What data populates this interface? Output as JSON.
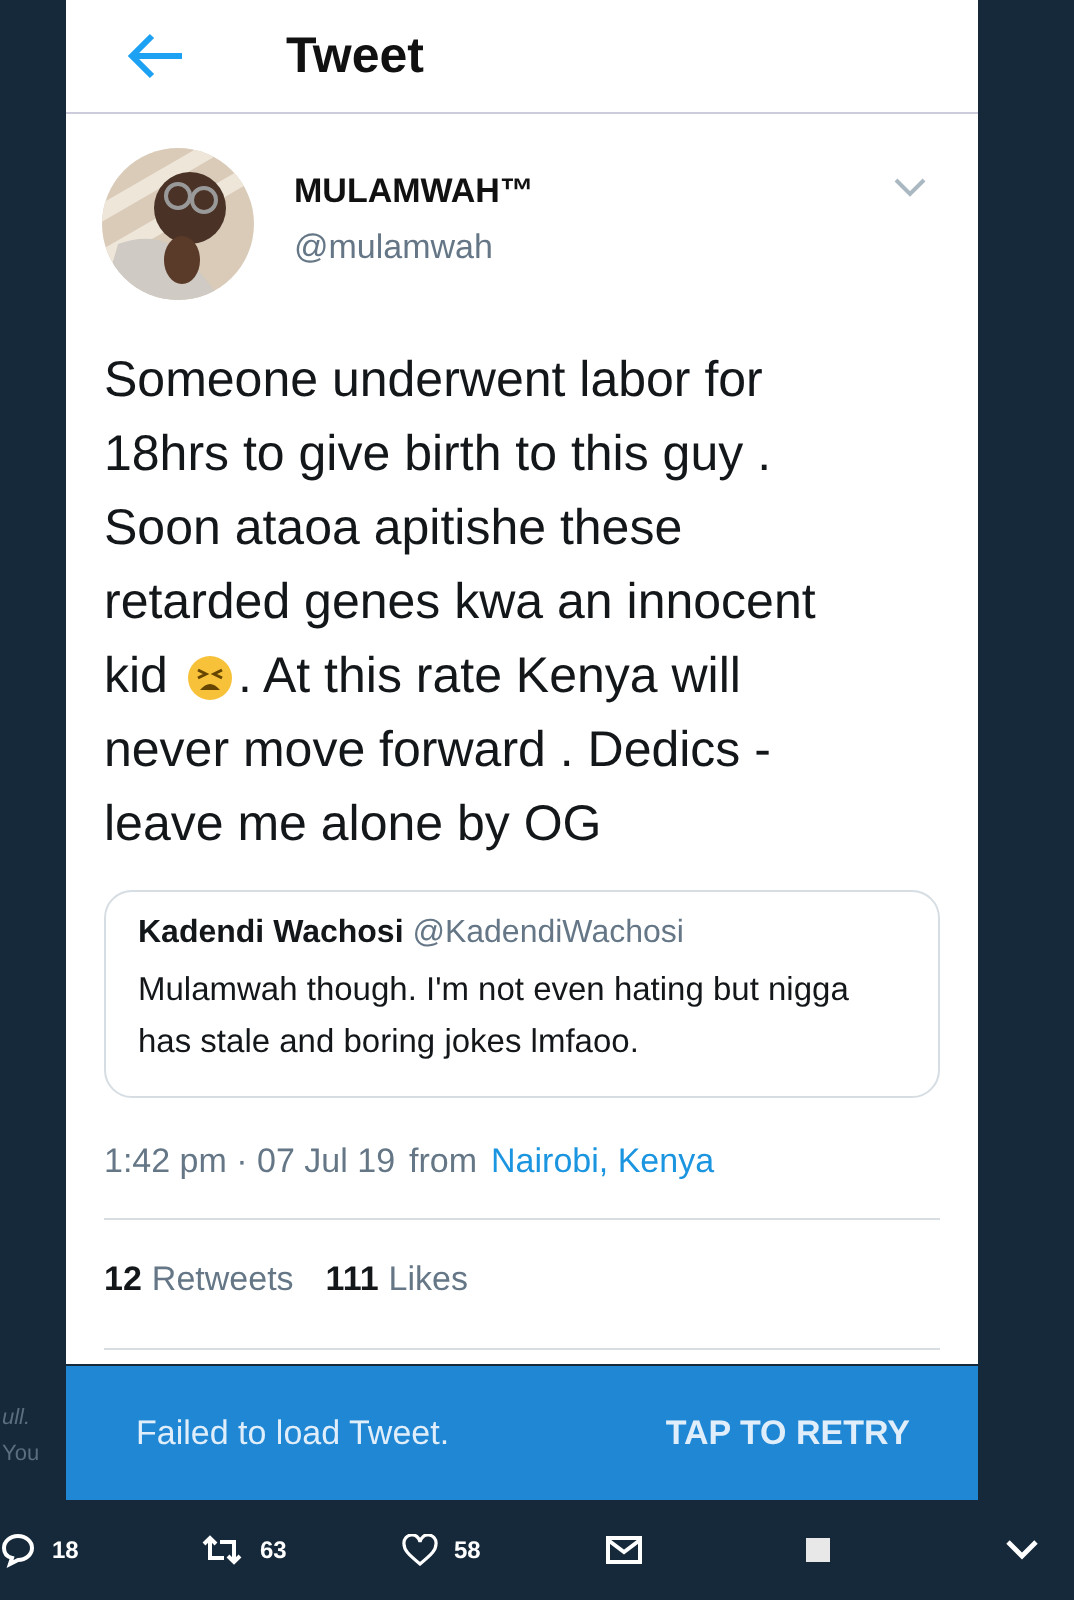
{
  "header": {
    "title": "Tweet"
  },
  "tweet": {
    "name": "MULAMWAH™",
    "handle": "@mulamwah",
    "lines": [
      [
        "Someone underwent labor for"
      ],
      [
        "18hrs to give birth to this guy ."
      ],
      [
        "Soon ataoa apitishe these"
      ],
      [
        "retarded genes kwa an innocent"
      ],
      [
        "kid",
        ". At this rate Kenya will"
      ],
      [
        "never move forward . Dedics -"
      ],
      [
        "leave me alone by OG"
      ]
    ],
    "quote": {
      "name": "Kadendi Wachosi",
      "handle": "@KadendiWachosi",
      "text": "Mulamwah though. I'm not even hating but nigga has stale and boring jokes lmfaoo."
    },
    "time": "1:42 pm · 07 Jul 19",
    "from": "from",
    "place": "Nairobi, Kenya",
    "stats": [
      {
        "count": "12",
        "label": "Retweets"
      },
      {
        "count": "111",
        "label": "Likes"
      }
    ]
  },
  "background": {
    "line_1": "ull.",
    "line_2": "You"
  },
  "banner": {
    "message": "Failed to load Tweet.",
    "action": "TAP TO RETRY"
  },
  "actions": [
    {
      "kind": "reply",
      "count": "18"
    },
    {
      "kind": "retweet",
      "count": "63"
    },
    {
      "kind": "like",
      "count": "58"
    },
    {
      "kind": "mail"
    },
    {
      "kind": "square"
    },
    {
      "kind": "more"
    }
  ]
}
